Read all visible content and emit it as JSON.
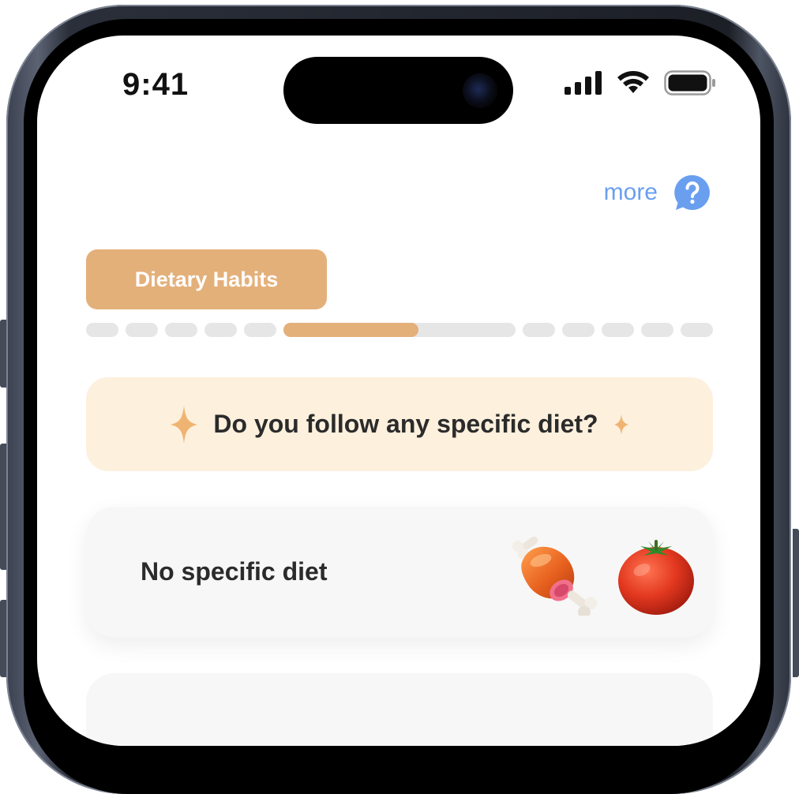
{
  "status_bar": {
    "time": "9:41"
  },
  "header": {
    "more_label": "more",
    "help_icon": "question-bubble-icon"
  },
  "section": {
    "label": "Dietary Habits"
  },
  "progress": {
    "total_steps": 11,
    "current_step": 6,
    "current_step_progress": 0.58
  },
  "question": {
    "text": "Do you follow any specific diet?",
    "decoration_icon": "sparkle-icon"
  },
  "options": [
    {
      "label": "No specific diet",
      "icons": [
        "meat-leg-icon",
        "tomato-icon"
      ]
    }
  ],
  "colors": {
    "accent": "#e4b07a",
    "question_bg": "#fdf0dd",
    "link": "#6a9ff0",
    "sparkle": "#f0b472",
    "text": "#2b2b2b"
  }
}
